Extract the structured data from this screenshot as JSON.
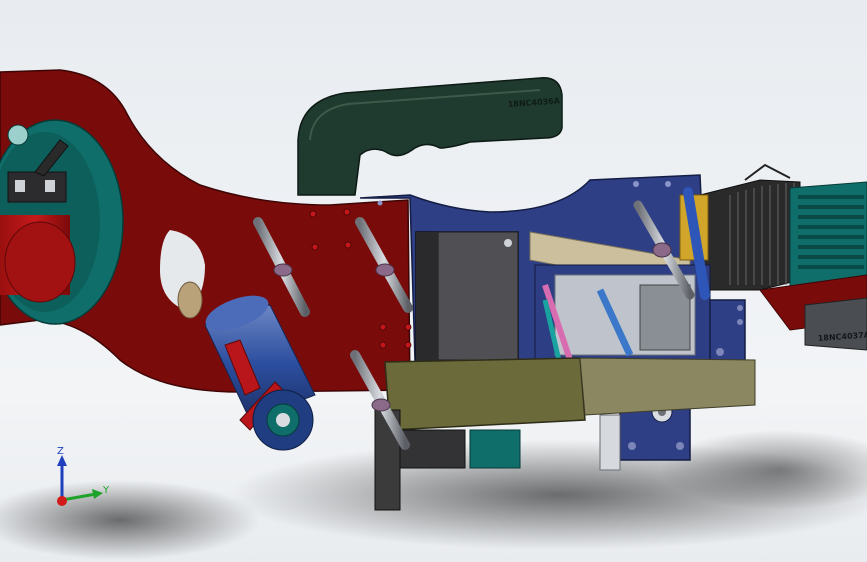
{
  "part_labels": {
    "handle": "18NC4036A",
    "rail": "18NC4037A"
  },
  "triad": {
    "z_label": "Z",
    "y_label": "Y"
  },
  "colors": {
    "frame_red": "#7a0b0b",
    "plate_blue": "#2f3f86",
    "handle_green": "#1f3a2e",
    "bracket_olive": "#6b6a3a",
    "motor_gray": "#3a3a3c",
    "drum_teal": "#0f6e6a",
    "background": "#eef1f4"
  }
}
